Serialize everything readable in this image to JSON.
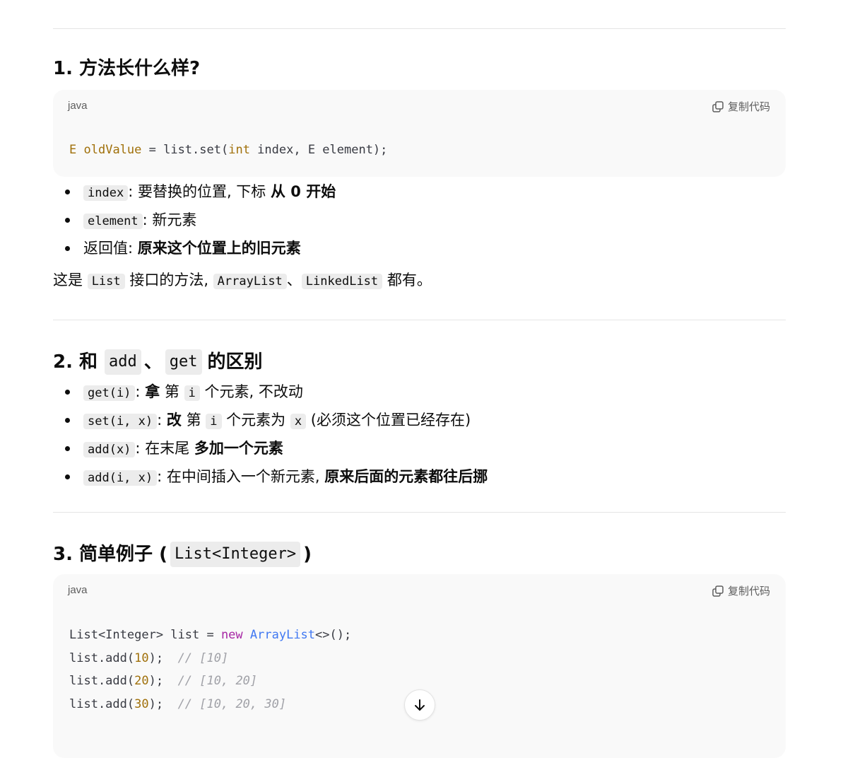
{
  "section1": {
    "heading": "1. 方法长什么样?",
    "code_lang": "java",
    "copy_label": "复制代码",
    "code": {
      "t1": "E",
      "t2": " ",
      "t3": "oldValue",
      "t4": " = list.set(",
      "t5": "int",
      "t6": " index, E element);"
    },
    "bullets": [
      {
        "code": "index",
        "sep": ": ",
        "text": "要替换的位置, 下标 ",
        "bold": "从 0 开始"
      },
      {
        "code": "element",
        "sep": ": ",
        "text": "新元素"
      },
      {
        "plain": "返回值: ",
        "bold": "原来这个位置上的旧元素"
      }
    ],
    "para": {
      "p1": "这是 ",
      "c1": "List",
      "p2": " 接口的方法, ",
      "c2": "ArrayList",
      "p3": "、",
      "c3": "LinkedList",
      "p4": " 都有。"
    }
  },
  "section2": {
    "heading_prefix": "2. 和",
    "heading_code1": "add",
    "heading_sep": "、",
    "heading_code2": "get",
    "heading_suffix": "的区别",
    "bullets": [
      {
        "code": "get(i)",
        "sep": ": ",
        "bold": "拿",
        "t1": " 第 ",
        "code2": "i",
        "t2": " 个元素, 不改动"
      },
      {
        "code": "set(i, x)",
        "sep": ": ",
        "bold": "改",
        "t1": " 第 ",
        "code2": "i",
        "t2": " 个元素为 ",
        "code3": "x",
        "t3": " (必须这个位置已经存在)"
      },
      {
        "code": "add(x)",
        "sep": ": ",
        "t1": "在末尾 ",
        "bold": "多加一个元素"
      },
      {
        "code": "add(i, x)",
        "sep": ": ",
        "t1": "在中间插入一个新元素, ",
        "bold": "原来后面的元素都往后挪"
      }
    ]
  },
  "section3": {
    "heading_prefix": "3. 简单例子 (",
    "heading_code": "List<Integer>",
    "heading_suffix": ")",
    "code_lang": "java",
    "copy_label": "复制代码",
    "lines": [
      {
        "a": "List<Integer> list = ",
        "kw": "new",
        "sp": " ",
        "cls": "ArrayList",
        "b": "<>();"
      },
      {
        "a": "list.add(",
        "num": "10",
        "b": ");  ",
        "cmt": "// [10]"
      },
      {
        "a": "list.add(",
        "num": "20",
        "b": ");  ",
        "cmt": "// [10, 20]"
      },
      {
        "a": "list.add(",
        "num": "30",
        "b": ");  ",
        "cmt": "// [10, 20, 30]"
      }
    ]
  },
  "icons": {
    "copy": "copy-icon",
    "scroll": "arrow-down-icon"
  }
}
